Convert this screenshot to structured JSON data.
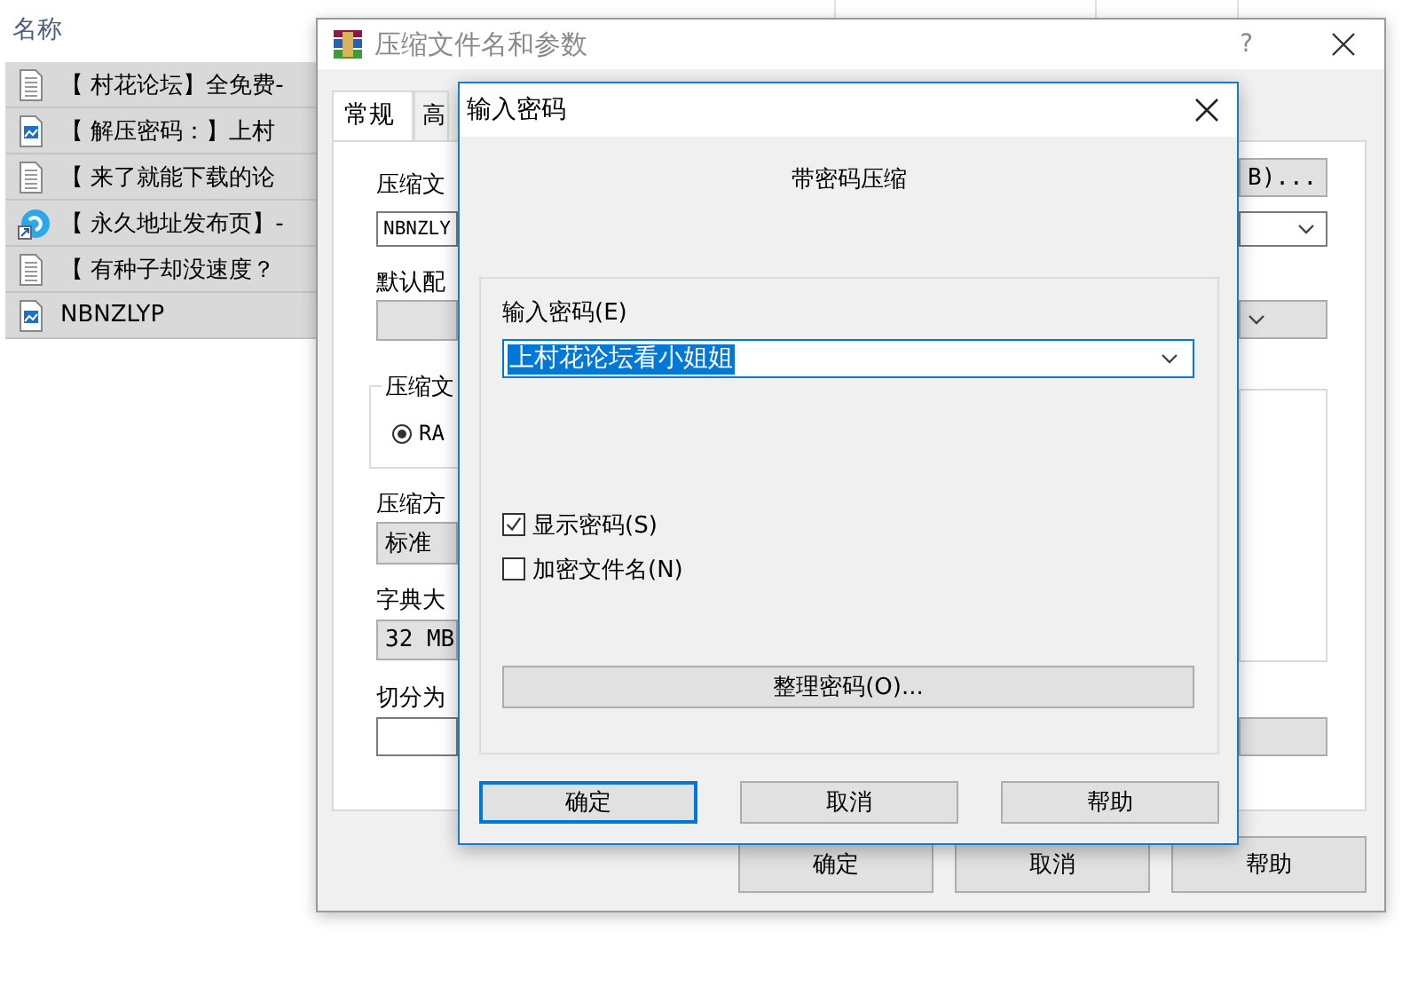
{
  "explorer": {
    "columns": [
      {
        "label": "名称"
      }
    ],
    "files": [
      {
        "name": "【 村花论坛】全免费-",
        "kind": "text"
      },
      {
        "name": "【 解压密码：】上村",
        "kind": "image"
      },
      {
        "name": "【 来了就能下载的论",
        "kind": "text"
      },
      {
        "name": "【 永久地址发布页】-",
        "kind": "shortcut"
      },
      {
        "name": "【 有种子却没速度？",
        "kind": "text"
      },
      {
        "name": "NBNZLYP",
        "kind": "image"
      }
    ]
  },
  "archive_dialog": {
    "title": "压缩文件名和参数",
    "help": "?",
    "tabs": [
      {
        "label": "常规",
        "selected": true
      },
      {
        "label": "高",
        "selected": false
      }
    ],
    "left_controls": [
      {
        "kind": "label",
        "text": "压缩文"
      },
      {
        "kind": "field",
        "text": "NBNZLY"
      },
      {
        "kind": "label",
        "text": "默认配"
      },
      {
        "kind": "dropdown"
      },
      {
        "kind": "group",
        "text": "压缩文",
        "option": {
          "text": "RA",
          "selected": true
        }
      },
      {
        "kind": "label",
        "text": "压缩方"
      },
      {
        "kind": "dropdown",
        "text": "标准"
      },
      {
        "kind": "label",
        "text": "字典大"
      },
      {
        "kind": "dropdown",
        "text": "32 MB"
      },
      {
        "kind": "label",
        "text": "切分为"
      },
      {
        "kind": "field"
      }
    ],
    "right_controls": [
      {
        "kind": "button",
        "text": "B)..."
      },
      {
        "kind": "combo"
      },
      {
        "kind": "dropdown"
      },
      {
        "kind": "list"
      },
      {
        "kind": "button"
      }
    ],
    "buttons": [
      "确定",
      "取消",
      "帮助"
    ]
  },
  "password_dialog": {
    "title": "输入密码",
    "heading": "带密码压缩",
    "password_label": "输入密码(E)",
    "password": "上村花论坛看小姐姐",
    "password_selected": true,
    "options": [
      {
        "label": "显示密码(S)",
        "checked": true
      },
      {
        "label": "加密文件名(N)",
        "checked": false
      }
    ],
    "organize_button": "整理密码(O)...",
    "buttons": [
      {
        "label": "确定",
        "default": true
      },
      {
        "label": "取消",
        "default": false
      },
      {
        "label": "帮助",
        "default": false
      }
    ]
  }
}
